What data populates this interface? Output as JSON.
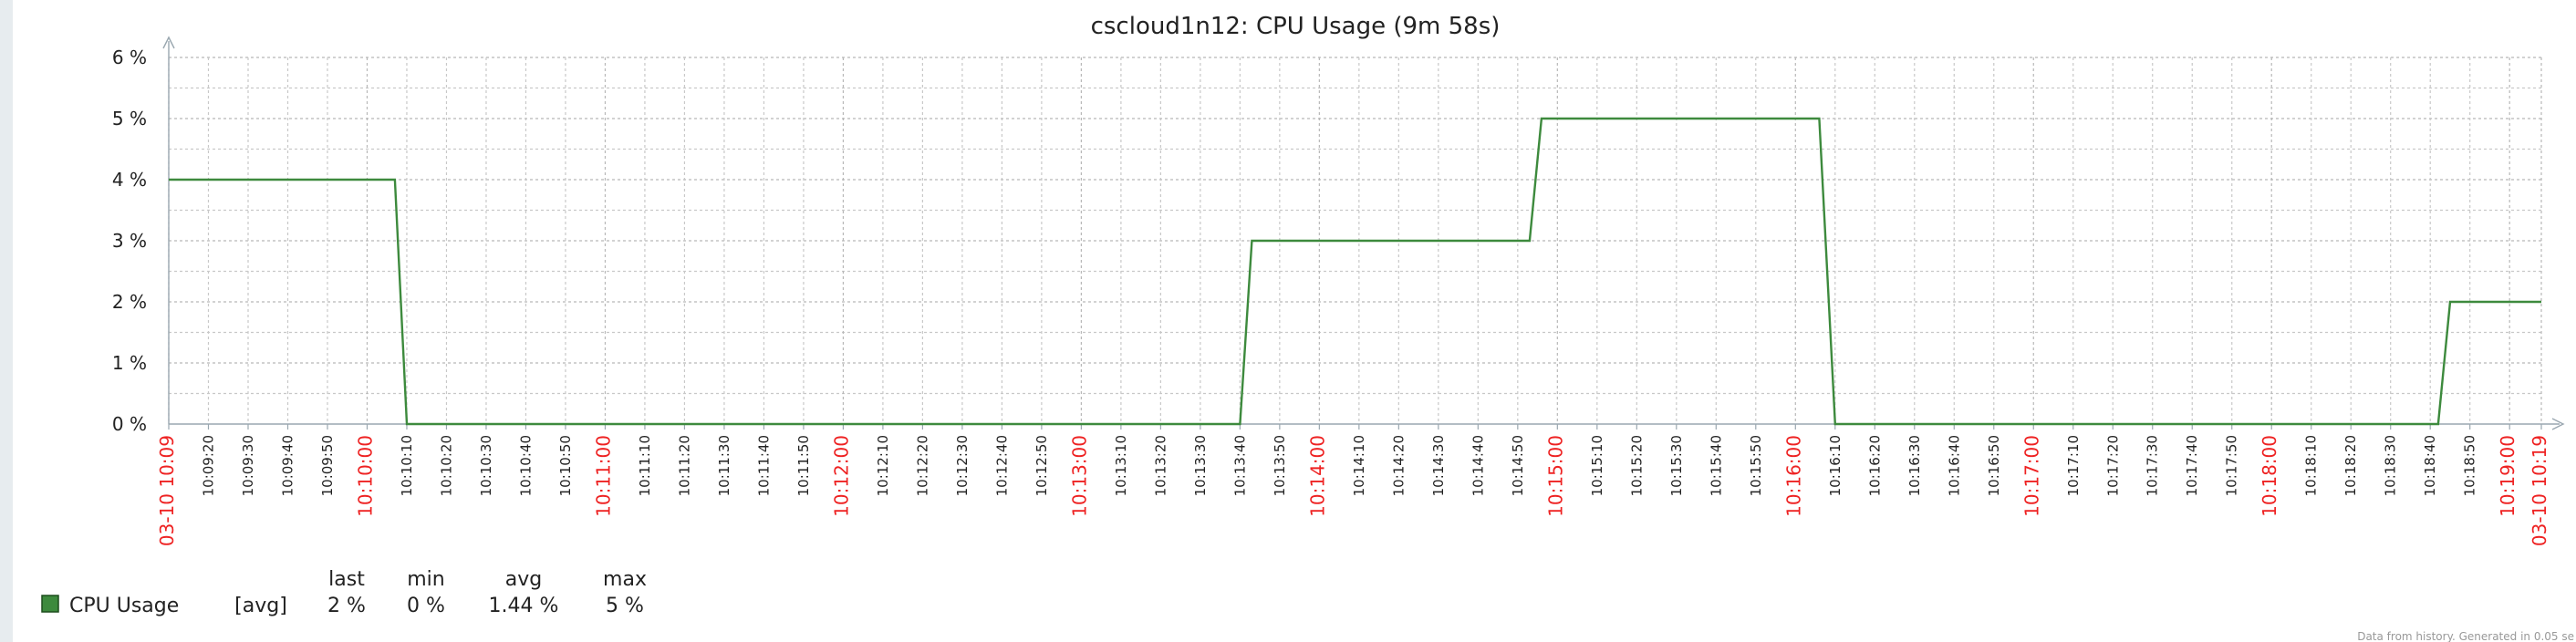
{
  "chart_data": {
    "type": "line",
    "title": "cscloud1n12: CPU Usage (9m 58s)",
    "y_ticks": [
      "0 %",
      "1 %",
      "2 %",
      "3 %",
      "4 %",
      "5 %",
      "6 %"
    ],
    "ylim": [
      0,
      6
    ],
    "grid": true,
    "x_start_label": "03-10 10:09",
    "x_end_label": "03-10 10:19",
    "x_tick_labels": [
      "10:09:20",
      "10:09:30",
      "10:09:40",
      "10:09:50",
      "10:10:00",
      "10:10:10",
      "10:10:20",
      "10:10:30",
      "10:10:40",
      "10:10:50",
      "10:11:00",
      "10:11:10",
      "10:11:20",
      "10:11:30",
      "10:11:40",
      "10:11:50",
      "10:12:00",
      "10:12:10",
      "10:12:20",
      "10:12:30",
      "10:12:40",
      "10:12:50",
      "10:13:00",
      "10:13:10",
      "10:13:20",
      "10:13:30",
      "10:13:40",
      "10:13:50",
      "10:14:00",
      "10:14:10",
      "10:14:20",
      "10:14:30",
      "10:14:40",
      "10:14:50",
      "10:15:00",
      "10:15:10",
      "10:15:20",
      "10:15:30",
      "10:15:40",
      "10:15:50",
      "10:16:00",
      "10:16:10",
      "10:16:20",
      "10:16:30",
      "10:16:40",
      "10:16:50",
      "10:17:00",
      "10:17:10",
      "10:17:20",
      "10:17:30",
      "10:17:40",
      "10:17:50",
      "10:18:00",
      "10:18:10",
      "10:18:20",
      "10:18:30",
      "10:18:40",
      "10:18:50",
      "10:19:00"
    ],
    "series": [
      {
        "name": "CPU Usage",
        "color": "#3d8a3d",
        "x": [
          "10:09:10",
          "10:10:07",
          "10:10:10",
          "10:13:40",
          "10:13:43",
          "10:14:53",
          "10:14:56",
          "10:16:06",
          "10:16:10",
          "10:18:42",
          "10:18:45",
          "10:19:08"
        ],
        "y": [
          4,
          4,
          0,
          0,
          3,
          3,
          5,
          5,
          0,
          0,
          2,
          2
        ]
      }
    ],
    "legend": {
      "headers": [
        "last",
        "min",
        "avg",
        "max"
      ],
      "rows": [
        {
          "name": "CPU Usage",
          "func": "[avg]",
          "last": "2 %",
          "min": "0 %",
          "avg": "1.44 %",
          "max": "5 %",
          "color": "#3d8a3d"
        }
      ]
    }
  },
  "footer_note": "Data from history. Generated in 0.05 se"
}
